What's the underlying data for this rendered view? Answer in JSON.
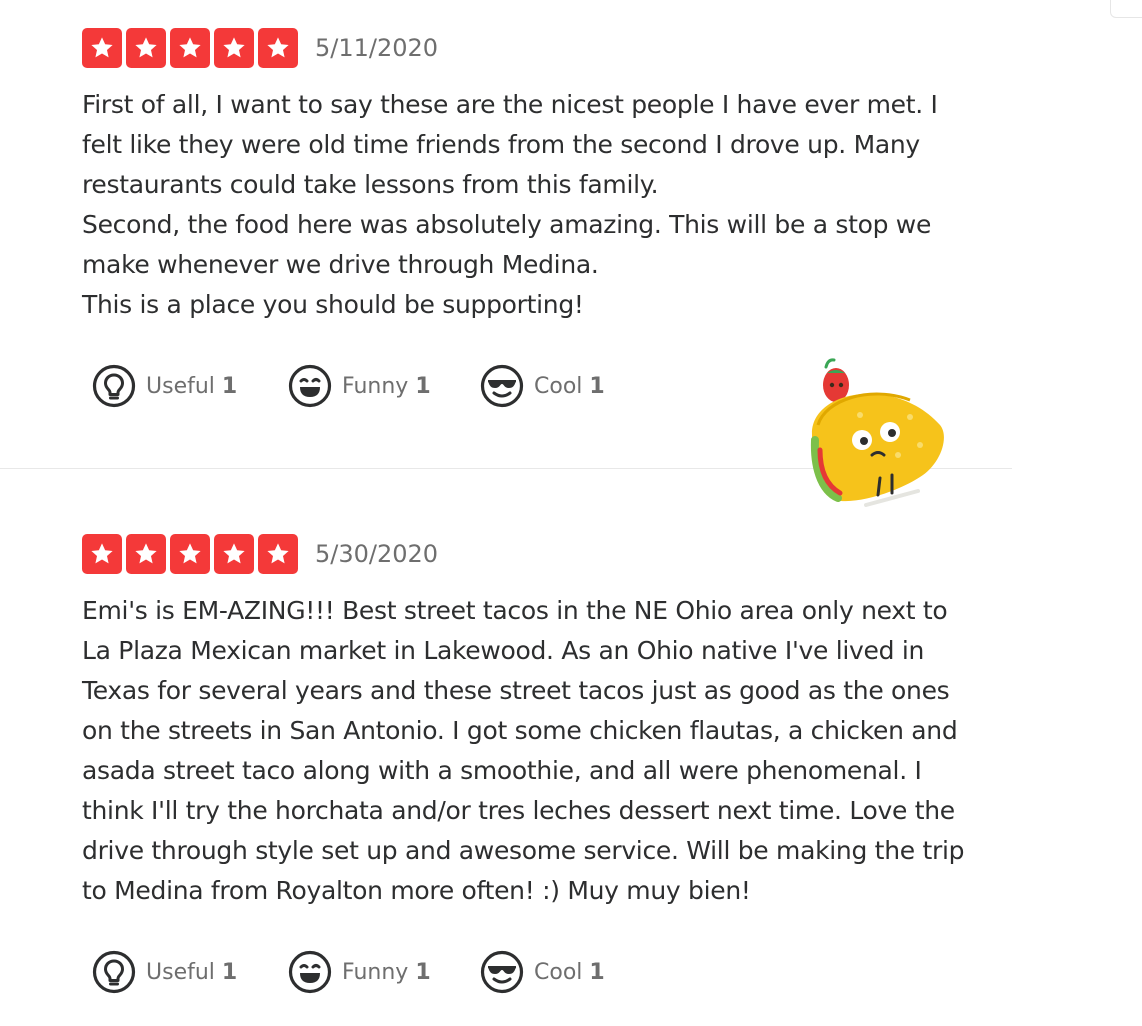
{
  "colors": {
    "star_bg": "#f43939",
    "star_fill": "#ffffff",
    "icon_stroke": "#2d2e2f",
    "meta_text": "#6e6e6e",
    "body_text": "#2d2e2f"
  },
  "reviews": [
    {
      "rating": 5,
      "date": "5/11/2020",
      "text": "First of all, I want to say these are the nicest people I have ever met. I\nfelt like they were old time friends from the second I drove up. Many\nrestaurants could take lessons from this family.\nSecond, the food here was absolutely amazing. This will be a stop we\nmake whenever we drive through Medina.\nThis is a place you should be supporting!",
      "actions": {
        "useful": {
          "label": "Useful",
          "count": "1",
          "icon": "lightbulb-icon"
        },
        "funny": {
          "label": "Funny",
          "count": "1",
          "icon": "laughing-face-icon"
        },
        "cool": {
          "label": "Cool",
          "count": "1",
          "icon": "sunglasses-face-icon"
        }
      }
    },
    {
      "rating": 5,
      "date": "5/30/2020",
      "text": "Emi's is EM-AZING!!! Best street tacos in the NE Ohio area only next to\nLa Plaza Mexican market in Lakewood. As an Ohio native I've lived in\nTexas for several years and these street tacos just as good as the ones\non the streets in San Antonio. I got some chicken flautas, a chicken and\nasada street taco along with a smoothie, and all were phenomenal. I\nthink I'll try the horchata and/or tres leches dessert next time. Love the\ndrive through style set up and awesome service. Will be making the trip\nto Medina from Royalton more often! :) Muy muy bien!",
      "actions": {
        "useful": {
          "label": "Useful",
          "count": "1",
          "icon": "lightbulb-icon"
        },
        "funny": {
          "label": "Funny",
          "count": "1",
          "icon": "laughing-face-icon"
        },
        "cool": {
          "label": "Cool",
          "count": "1",
          "icon": "sunglasses-face-icon"
        }
      }
    }
  ],
  "illustration": {
    "icon": "taco-mascot-icon"
  }
}
